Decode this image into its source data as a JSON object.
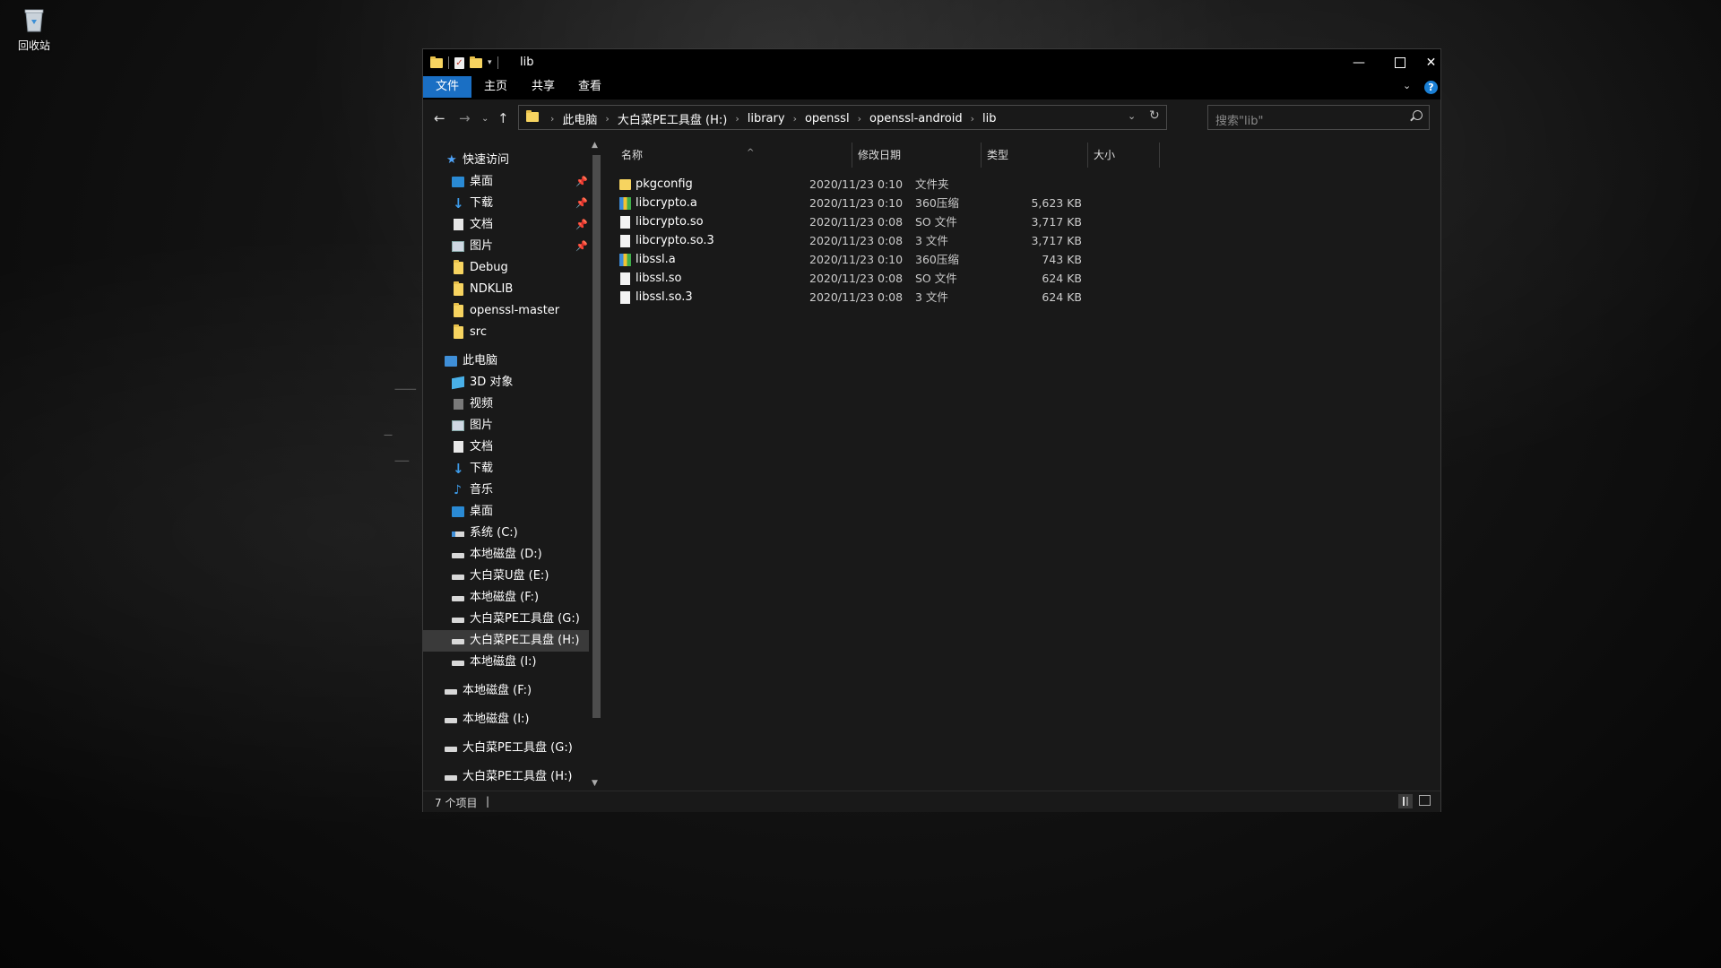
{
  "desktop": {
    "recycle_bin_label": "回收站"
  },
  "window": {
    "title": "lib",
    "ribbon_tabs": [
      "文件",
      "主页",
      "共享",
      "查看"
    ],
    "help_label": "?"
  },
  "address": {
    "crumbs": [
      "此电脑",
      "大白菜PE工具盘 (H:)",
      "library",
      "openssl",
      "openssl-android",
      "lib"
    ]
  },
  "search": {
    "placeholder": "搜索\"lib\""
  },
  "navpane": {
    "quick_access": "快速访问",
    "quick_items": [
      {
        "label": "桌面",
        "icon": "desktop-icon",
        "pinned": true
      },
      {
        "label": "下载",
        "icon": "download-icon",
        "pinned": true
      },
      {
        "label": "文档",
        "icon": "document-icon",
        "pinned": true
      },
      {
        "label": "图片",
        "icon": "picture-icon",
        "pinned": true
      },
      {
        "label": "Debug",
        "icon": "folder-icon",
        "pinned": false
      },
      {
        "label": "NDKLIB",
        "icon": "folder-icon",
        "pinned": false
      },
      {
        "label": "openssl-master",
        "icon": "folder-icon",
        "pinned": false
      },
      {
        "label": "src",
        "icon": "folder-icon",
        "pinned": false
      }
    ],
    "this_pc": "此电脑",
    "pc_items": [
      {
        "label": "3D 对象",
        "icon": "3d-objects-icon"
      },
      {
        "label": "视频",
        "icon": "video-icon"
      },
      {
        "label": "图片",
        "icon": "picture-icon"
      },
      {
        "label": "文档",
        "icon": "document-icon"
      },
      {
        "label": "下载",
        "icon": "download-icon"
      },
      {
        "label": "音乐",
        "icon": "music-icon"
      },
      {
        "label": "桌面",
        "icon": "desktop-icon"
      },
      {
        "label": "系统 (C:)",
        "icon": "system-drive-icon"
      },
      {
        "label": "本地磁盘 (D:)",
        "icon": "drive-icon"
      },
      {
        "label": "大白菜U盘 (E:)",
        "icon": "drive-icon"
      },
      {
        "label": "本地磁盘 (F:)",
        "icon": "drive-icon"
      },
      {
        "label": "大白菜PE工具盘 (G:)",
        "icon": "drive-icon"
      },
      {
        "label": "大白菜PE工具盘 (H:)",
        "icon": "drive-icon",
        "selected": true
      },
      {
        "label": "本地磁盘 (I:)",
        "icon": "drive-icon"
      }
    ],
    "root_drives": [
      "本地磁盘 (F:)",
      "本地磁盘 (I:)",
      "大白菜PE工具盘 (G:)",
      "大白菜PE工具盘 (H:)"
    ]
  },
  "filelist": {
    "columns": [
      "名称",
      "修改日期",
      "类型",
      "大小"
    ],
    "rows": [
      {
        "name": "pkgconfig",
        "date": "2020/11/23 0:10",
        "type": "文件夹",
        "size": "",
        "icon": "folder"
      },
      {
        "name": "libcrypto.a",
        "date": "2020/11/23 0:10",
        "type": "360压缩",
        "size": "5,623 KB",
        "icon": "zip"
      },
      {
        "name": "libcrypto.so",
        "date": "2020/11/23 0:08",
        "type": "SO 文件",
        "size": "3,717 KB",
        "icon": "file"
      },
      {
        "name": "libcrypto.so.3",
        "date": "2020/11/23 0:08",
        "type": "3 文件",
        "size": "3,717 KB",
        "icon": "file"
      },
      {
        "name": "libssl.a",
        "date": "2020/11/23 0:10",
        "type": "360压缩",
        "size": "743 KB",
        "icon": "zip"
      },
      {
        "name": "libssl.so",
        "date": "2020/11/23 0:08",
        "type": "SO 文件",
        "size": "624 KB",
        "icon": "file"
      },
      {
        "name": "libssl.so.3",
        "date": "2020/11/23 0:08",
        "type": "3 文件",
        "size": "624 KB",
        "icon": "file"
      }
    ]
  },
  "status": {
    "item_count": "7 个项目",
    "separator": "|"
  }
}
